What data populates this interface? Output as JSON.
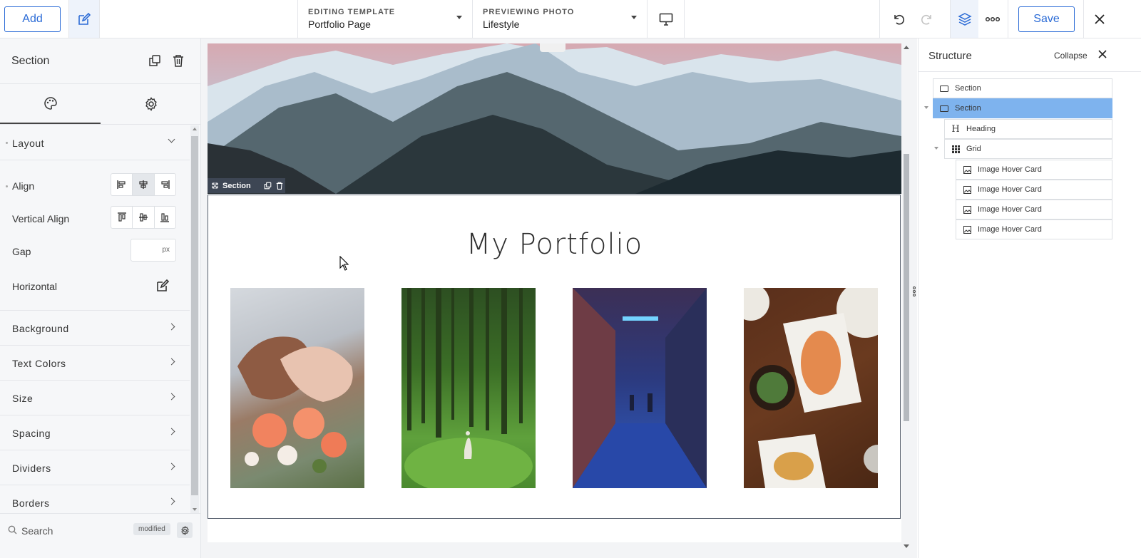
{
  "toolbar": {
    "add_label": "Add",
    "template_key": "EDITING TEMPLATE",
    "template_value": "Portfolio Page",
    "preview_key": "PREVIEWING PHOTO",
    "preview_value": "Lifestyle",
    "save_label": "Save",
    "icons": [
      "edit-icon",
      "desktop-icon",
      "undo-icon",
      "redo-icon",
      "layers-icon",
      "more-icon",
      "close-icon"
    ]
  },
  "left_panel": {
    "title": "Section",
    "tabs": [
      "palette-icon",
      "gear-icon"
    ],
    "layout_label": "Layout",
    "props": {
      "align": "Align",
      "vertical_align": "Vertical Align",
      "gap": "Gap",
      "gap_unit": "px",
      "horizontal": "Horizontal"
    },
    "sections": [
      "Background",
      "Text Colors",
      "Size",
      "Spacing",
      "Dividers",
      "Borders"
    ],
    "search_placeholder": "Search",
    "modified_badge": "modified"
  },
  "canvas": {
    "section_tag": "Section",
    "heading": "My Portfolio",
    "cards": [
      {
        "name": "wedding-rings-bouquet-photo",
        "colors": [
          "#c9cdd3",
          "#8a5a44",
          "#f08a6c"
        ]
      },
      {
        "name": "forest-walker-photo",
        "colors": [
          "#3f6f2a",
          "#62a33a",
          "#2c4d1f"
        ]
      },
      {
        "name": "neon-alley-photo",
        "colors": [
          "#2a3a86",
          "#3aa3e0",
          "#5a3a5e"
        ]
      },
      {
        "name": "food-table-photo",
        "colors": [
          "#5a2e1a",
          "#e9e6e0",
          "#d9824a"
        ]
      }
    ]
  },
  "structure_panel": {
    "title": "Structure",
    "collapse_label": "Collapse",
    "nodes": [
      {
        "label": "Section",
        "icon": "section-icon"
      },
      {
        "label": "Section",
        "icon": "section-icon"
      },
      {
        "label": "Heading",
        "icon": "heading-icon"
      },
      {
        "label": "Grid",
        "icon": "grid-icon"
      },
      {
        "label": "Image Hover Card",
        "icon": "image-icon"
      },
      {
        "label": "Image Hover Card",
        "icon": "image-icon"
      },
      {
        "label": "Image Hover Card",
        "icon": "image-icon"
      },
      {
        "label": "Image Hover Card",
        "icon": "image-icon"
      }
    ],
    "selected_color": "#7eb3ee"
  },
  "colors": {
    "accent": "#2b6bd6",
    "panel_bg": "#f6f7f9"
  }
}
